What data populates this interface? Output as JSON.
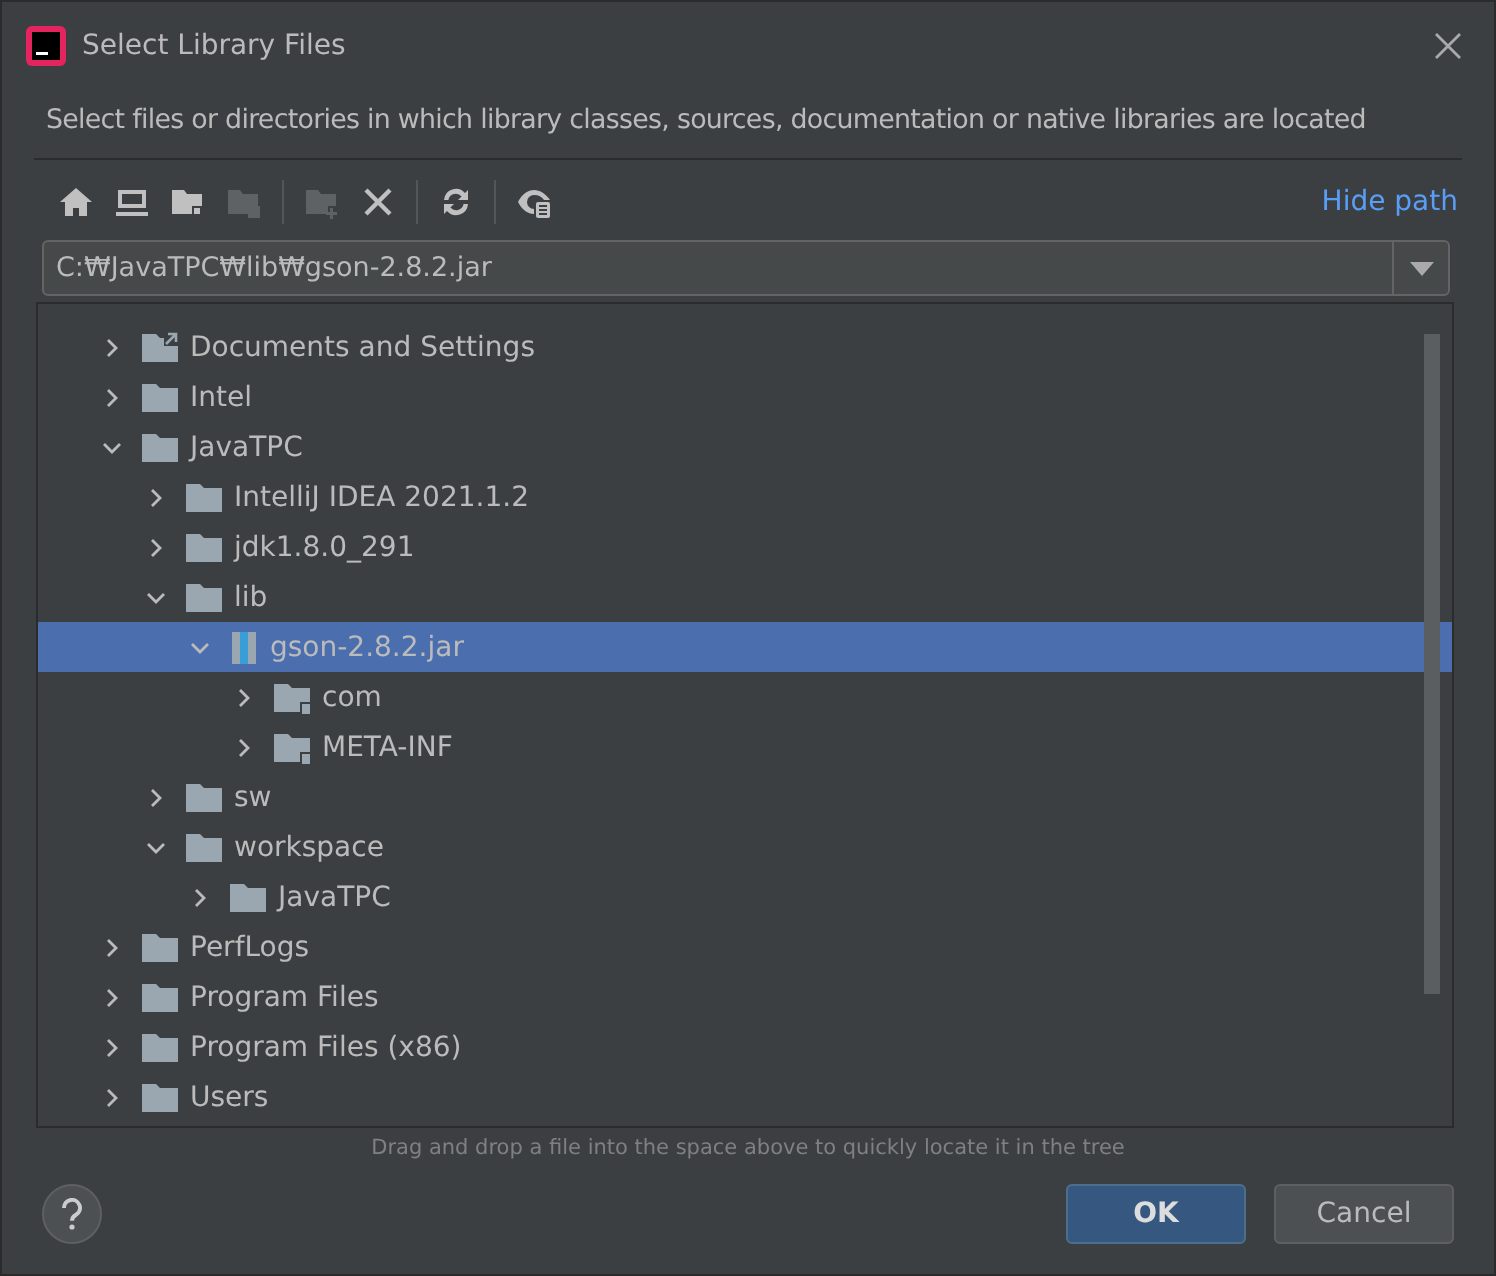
{
  "window": {
    "title": "Select Library Files"
  },
  "description": "Select files or directories in which library classes, sources, documentation or native libraries are located",
  "toolbar": {
    "buttons": [
      {
        "kind": "home",
        "disabled": false
      },
      {
        "kind": "desktop",
        "disabled": false
      },
      {
        "kind": "new-folder",
        "disabled": false
      },
      {
        "kind": "folder",
        "disabled": true
      },
      {
        "kind": "add-folder",
        "disabled": true
      },
      {
        "kind": "delete",
        "disabled": false
      },
      {
        "kind": "refresh",
        "disabled": false
      },
      {
        "kind": "hidden",
        "disabled": false
      }
    ],
    "link": "Hide path"
  },
  "path": {
    "value": "C:₩JavaTPC₩lib₩gson-2.8.2.jar"
  },
  "tree": [
    {
      "name": "Documents and Settings",
      "kind": "link-folder",
      "expanded": false,
      "selected": false
    },
    {
      "name": "Intel",
      "kind": "folder",
      "expanded": false,
      "selected": false
    },
    {
      "name": "JavaTPC",
      "kind": "folder",
      "expanded": true,
      "selected": false,
      "children": [
        {
          "name": "IntelliJ IDEA 2021.1.2",
          "kind": "folder",
          "expanded": false,
          "selected": false
        },
        {
          "name": "jdk1.8.0_291",
          "kind": "folder",
          "expanded": false,
          "selected": false
        },
        {
          "name": "lib",
          "kind": "folder",
          "expanded": true,
          "selected": false,
          "children": [
            {
              "name": "gson-2.8.2.jar",
              "kind": "jar",
              "expanded": true,
              "selected": true,
              "children": [
                {
                  "name": "com",
                  "kind": "package",
                  "expanded": false,
                  "selected": false
                },
                {
                  "name": "META-INF",
                  "kind": "package",
                  "expanded": false,
                  "selected": false
                }
              ]
            }
          ]
        },
        {
          "name": "sw",
          "kind": "folder",
          "expanded": false,
          "selected": false
        },
        {
          "name": "workspace",
          "kind": "folder",
          "expanded": true,
          "selected": false,
          "children": [
            {
              "name": "JavaTPC",
              "kind": "folder",
              "expanded": false,
              "selected": false
            }
          ]
        }
      ]
    },
    {
      "name": "PerfLogs",
      "kind": "folder",
      "expanded": false,
      "selected": false
    },
    {
      "name": "Program Files",
      "kind": "folder",
      "expanded": false,
      "selected": false
    },
    {
      "name": "Program Files (x86)",
      "kind": "folder",
      "expanded": false,
      "selected": false
    },
    {
      "name": "Users",
      "kind": "folder",
      "expanded": false,
      "selected": false
    }
  ],
  "hint": "Drag and drop a file into the space above to quickly locate it in the tree",
  "buttons": [
    {
      "label": "OK",
      "kind": "primary"
    },
    {
      "label": "Cancel",
      "kind": "secondary"
    }
  ]
}
